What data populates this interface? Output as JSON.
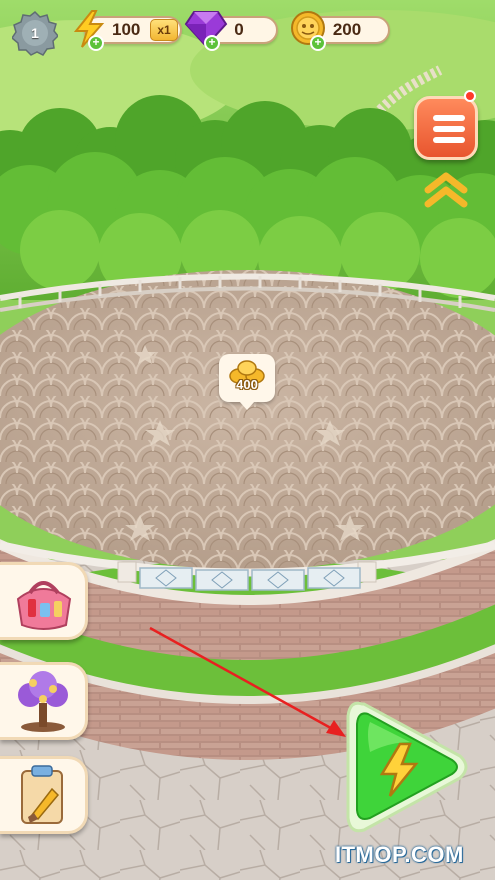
{
  "hud": {
    "level": "1",
    "energy": "100",
    "multiplier": "x1",
    "gems": "0",
    "coins": "200"
  },
  "reward_bubble": {
    "amount": "400"
  },
  "side_buttons": [
    {
      "icon": "cosmetics-bag-icon"
    },
    {
      "icon": "purple-tree-icon"
    },
    {
      "icon": "task-clipboard-icon"
    }
  ],
  "play_button": {
    "icon": "lightning-icon"
  },
  "menu_button": {
    "icon": "list-icon",
    "notification": true
  },
  "watermark": "ITMOP.COM",
  "colors": {
    "plaza": "#bfa897",
    "grass": "#6cbf3a",
    "play_button": "#3fd43a",
    "menu_button": "#f06a3c",
    "energy": "#ffcc22",
    "gem": "#9a3ad8",
    "coin": "#f5b82a"
  }
}
